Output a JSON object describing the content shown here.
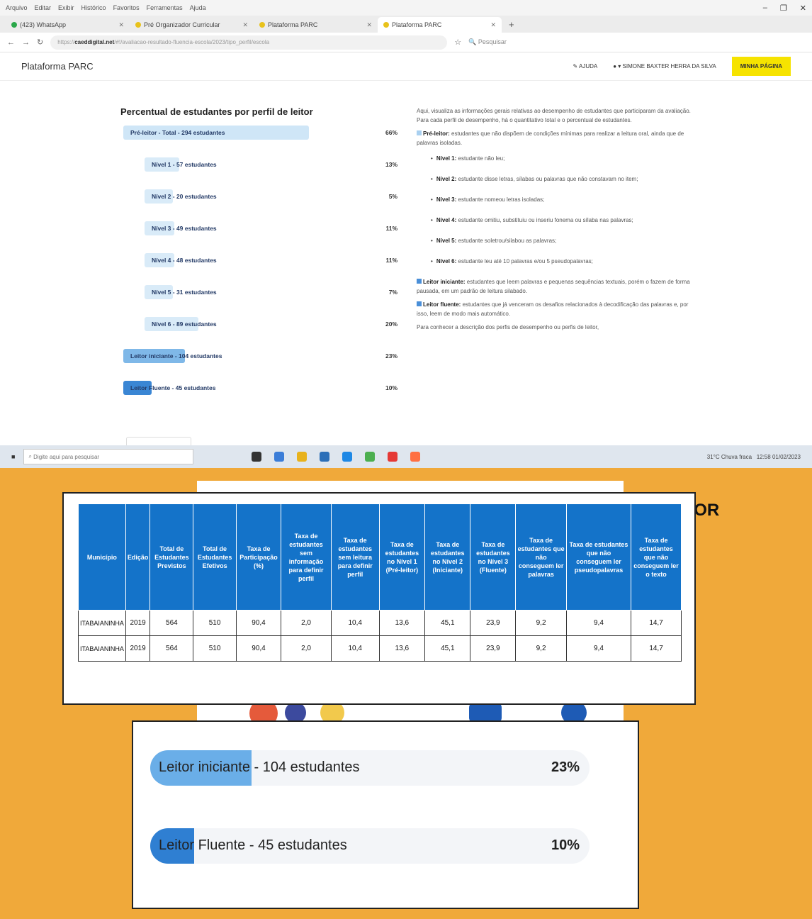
{
  "browser": {
    "menu": [
      "Arquivo",
      "Editar",
      "Exibir",
      "Histórico",
      "Favoritos",
      "Ferramentas",
      "Ajuda"
    ],
    "tabs": [
      {
        "label": "(423) WhatsApp",
        "active": false
      },
      {
        "label": "Pré Organizador Curricular",
        "active": false
      },
      {
        "label": "Plataforma PARC",
        "active": false
      },
      {
        "label": "Plataforma PARC",
        "active": true
      }
    ],
    "url_prefix": "https://",
    "url_domain": "caeddigital.net",
    "url_rest": "/#!/avaliacao-resultado-fluencia-escola/2023/tipo_perfil/escola",
    "search_placeholder": "Pesquisar",
    "app_title": "Plataforma PARC",
    "user_label": "SIMONE BAXTER HERRA DA SILVA",
    "help_label": "AJUDA",
    "yellow_button": "MINHA PÁGINA"
  },
  "chart": {
    "title": "Percentual de estudantes por perfil de leitor",
    "rows": [
      {
        "label": "Pré-leitor - Total - 294 estudantes",
        "pct": "66%",
        "indent": false,
        "color": "#cfe6f7",
        "fill": 0.66
      },
      {
        "label": "Nível 1 - 57 estudantes",
        "pct": "13%",
        "indent": true,
        "color": "#d9ebf8",
        "fill": 0.13
      },
      {
        "label": "Nível 2 - 20 estudantes",
        "pct": "5%",
        "indent": true,
        "color": "#d9ebf8",
        "fill": 0.05
      },
      {
        "label": "Nível 3 - 49 estudantes",
        "pct": "11%",
        "indent": true,
        "color": "#d9ebf8",
        "fill": 0.11
      },
      {
        "label": "Nível 4 - 48 estudantes",
        "pct": "11%",
        "indent": true,
        "color": "#d9ebf8",
        "fill": 0.11
      },
      {
        "label": "Nível 5 - 31 estudantes",
        "pct": "7%",
        "indent": true,
        "color": "#d9ebf8",
        "fill": 0.07
      },
      {
        "label": "Nível 6 - 89 estudantes",
        "pct": "20%",
        "indent": true,
        "color": "#d9ebf8",
        "fill": 0.2
      },
      {
        "label": "Leitor iniciante - 104 estudantes",
        "pct": "23%",
        "indent": false,
        "color": "#7fb8e8",
        "fill": 0.23
      },
      {
        "label": "Leitor Fluente - 45 estudantes",
        "pct": "10%",
        "indent": false,
        "color": "#3a86d4",
        "fill": 0.1
      }
    ]
  },
  "info": {
    "intro": "Aqui, visualiza as informações gerais relativas ao desempenho de estudantes que participaram da avaliação. Para cada perfil de desempenho, há o quantitativo total e o percentual de estudantes.",
    "pre_title": "Pré-leitor:",
    "pre_text": "estudantes que não dispõem de condições mínimas para realizar a leitura oral, ainda que de palavras isoladas.",
    "levels": [
      {
        "name": "Nível 1:",
        "text": "estudante não leu;"
      },
      {
        "name": "Nível 2:",
        "text": "estudante disse letras, sílabas ou palavras que não constavam no item;"
      },
      {
        "name": "Nível 3:",
        "text": "estudante nomeou letras isoladas;"
      },
      {
        "name": "Nível 4:",
        "text": "estudante omitiu, substituiu ou inseriu fonema ou sílaba nas palavras;"
      },
      {
        "name": "Nível 5:",
        "text": "estudante soletrou/silabou as palavras;"
      },
      {
        "name": "Nível 6:",
        "text": "estudante leu até 10 palavras e/ou 5 pseudopalavras;"
      }
    ],
    "ini_title": "Leitor iniciante:",
    "ini_text": "estudantes que leem palavras e pequenas sequências textuais, porém o fazem de forma pausada, em um padrão de leitura silabado.",
    "flu_title": "Leitor fluente:",
    "flu_text": "estudantes que já venceram os desafios relacionados à decodificação das palavras e, por isso, leem de modo mais automático.",
    "footer": "Para conhecer a descrição dos perfis de desempenho ou perfis de leitor,"
  },
  "taskbar": {
    "search_placeholder": "Digite aqui para pesquisar",
    "weather": "31°C Chuva fraca",
    "time": "12:58",
    "date": "01/02/2023"
  },
  "ghost_text": "TOR",
  "table": {
    "headers": [
      "Município",
      "Edição",
      "Total de Estudantes Previstos",
      "Total de Estudantes Efetivos",
      "Taxa de Participação (%)",
      "Taxa de estudantes sem informação para definir perfil",
      "Taxa de estudantes sem leitura para definir perfil",
      "Taxa de estudantes no Nível 1 (Pré-leitor)",
      "Taxa de estudantes no Nível 2 (Iniciante)",
      "Taxa de estudantes no Nível 3 (Fluente)",
      "Taxa de estudantes que não conseguem ler palavras",
      "Taxa de estudantes que não conseguem ler pseudopalavras",
      "Taxa de estudantes que não conseguem ler o texto"
    ],
    "rows": [
      [
        "ITABAIANINHA",
        "2019",
        "564",
        "510",
        "90,4",
        "2,0",
        "10,4",
        "13,6",
        "45,1",
        "23,9",
        "9,2",
        "9,4",
        "14,7"
      ],
      [
        "ITABAIANINHA",
        "2019",
        "564",
        "510",
        "90,4",
        "2,0",
        "10,4",
        "13,6",
        "45,1",
        "23,9",
        "9,2",
        "9,4",
        "14,7"
      ]
    ]
  },
  "zoom": {
    "rows": [
      {
        "label": "Leitor iniciante - 104 estudantes",
        "pct": "23%",
        "color": "#6aaee8",
        "fill": 0.23
      },
      {
        "label": "Leitor Fluente - 45 estudantes",
        "pct": "10%",
        "color": "#2f7fd2",
        "fill": 0.1
      }
    ]
  }
}
